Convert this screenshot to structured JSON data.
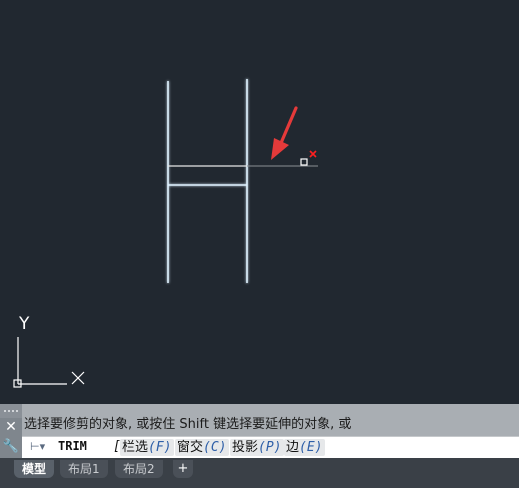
{
  "ucs": {
    "y_label": "Y",
    "x_label": "X"
  },
  "command": {
    "history_text": "选择要修剪的对象, 或按住 Shift 键选择要延伸的对象, 或",
    "close_label": "✕",
    "cmd_name": "TRIM",
    "bracket": "[",
    "options": [
      {
        "label": "栏选",
        "key": "(F)"
      },
      {
        "label": "窗交",
        "key": "(C)"
      },
      {
        "label": "投影",
        "key": "(P)"
      },
      {
        "label": "边",
        "key": "(E)"
      }
    ]
  },
  "tabs": {
    "model": "模型",
    "layout1": "布局1",
    "layout2": "布局2",
    "add": "+"
  },
  "colors": {
    "background": "#212830",
    "line_glow": "#9fd3ff",
    "arrow": "#e53a3a",
    "picker": "#ff2020"
  }
}
